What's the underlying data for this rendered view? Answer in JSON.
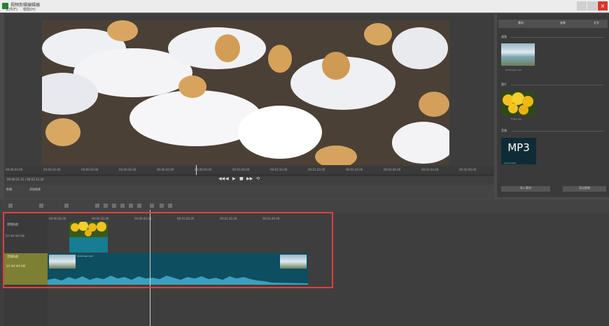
{
  "window": {
    "title": "视频剪辑编辑器",
    "menu_file": "文件(F)",
    "menu_help": "帮助(H)",
    "close_glyph": "×"
  },
  "ruler": {
    "ticks": [
      "00:00:00.00",
      "00:00:10.00",
      "00:00:20.00",
      "00:00:30.00",
      "00:00:40.00",
      "00:00:50.00",
      "00:01:00.00",
      "00:01:10.00",
      "00:01:20.00",
      "00:01:30.00",
      "00:01:40.00",
      "00:01:50.00",
      "00:02:00.00"
    ]
  },
  "player": {
    "timecode": "00:00:31.15 / 00:02:12.20",
    "btn_a": "剪辑",
    "btn_b": "添加效果",
    "controls": [
      "◀◀",
      "◀",
      "▶",
      "■",
      "▶▶",
      "⟲"
    ]
  },
  "right_panel": {
    "tabs": [
      "素材",
      "效果",
      "文字"
    ],
    "section_video": "视频",
    "section_image": "图片",
    "section_audio": "音频",
    "caption_landscape": "landscape.mp4",
    "caption_flower": "flower.jpg",
    "mp3_label": "MP3",
    "caption_mp3": "sound.mp3",
    "btn_import": "导入素材",
    "btn_export": "导出视频"
  },
  "timeline": {
    "ticks": [
      "00:00:00.00",
      "00:00:20.00",
      "00:00:40.00",
      "00:01:00.00",
      "00:01:20.00",
      "00:01:40.00"
    ],
    "video_track_label": "视频轨道",
    "video_track_controls": "显示 锁定 静音 隐藏",
    "audio_track_label": "音频轨道",
    "audio_track_controls": "显示 锁定 静音 隐藏",
    "audio_clip_label": "landscape.mp4"
  },
  "colors": {
    "highlight": "#e04040",
    "audio_track": "#7d7f33",
    "audio_clip": "#0d4e60"
  }
}
